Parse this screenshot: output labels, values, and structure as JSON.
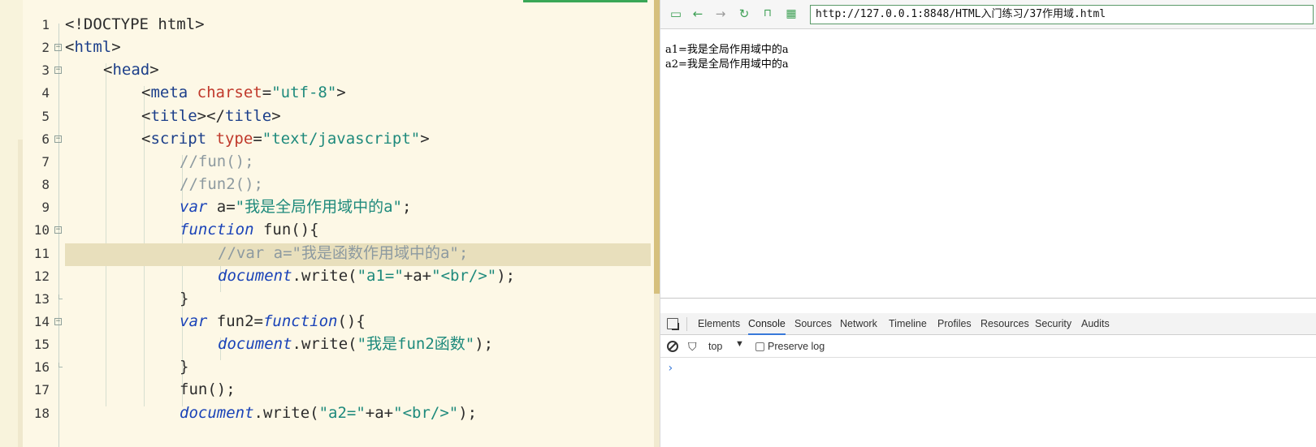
{
  "editor": {
    "lines": [
      {
        "n": "1",
        "fold": "",
        "indent": 0,
        "tokens": [
          [
            "t-punc",
            "<!DOCTYPE html>"
          ]
        ]
      },
      {
        "n": "2",
        "fold": "open",
        "indent": 0,
        "tokens": [
          [
            "t-punc",
            "<"
          ],
          [
            "t-tag",
            "html"
          ],
          [
            "t-punc",
            ">"
          ]
        ]
      },
      {
        "n": "3",
        "fold": "open",
        "indent": 1,
        "tokens": [
          [
            "t-punc",
            "<"
          ],
          [
            "t-tag",
            "head"
          ],
          [
            "t-punc",
            ">"
          ]
        ]
      },
      {
        "n": "4",
        "fold": "",
        "indent": 2,
        "tokens": [
          [
            "t-punc",
            "<"
          ],
          [
            "t-tag",
            "meta"
          ],
          [
            "t-id",
            " "
          ],
          [
            "t-attr",
            "charset"
          ],
          [
            "t-punc",
            "="
          ],
          [
            "t-str",
            "\"utf-8\""
          ],
          [
            "t-punc",
            ">"
          ]
        ]
      },
      {
        "n": "5",
        "fold": "",
        "indent": 2,
        "tokens": [
          [
            "t-punc",
            "<"
          ],
          [
            "t-tag",
            "title"
          ],
          [
            "t-punc",
            "></"
          ],
          [
            "t-tag",
            "title"
          ],
          [
            "t-punc",
            ">"
          ]
        ]
      },
      {
        "n": "6",
        "fold": "open",
        "indent": 2,
        "tokens": [
          [
            "t-punc",
            "<"
          ],
          [
            "t-tag",
            "script"
          ],
          [
            "t-id",
            " "
          ],
          [
            "t-attr",
            "type"
          ],
          [
            "t-punc",
            "="
          ],
          [
            "t-str",
            "\"text/javascript\""
          ],
          [
            "t-punc",
            ">"
          ]
        ]
      },
      {
        "n": "7",
        "fold": "",
        "indent": 3,
        "tokens": [
          [
            "t-cmt",
            "//fun();"
          ]
        ]
      },
      {
        "n": "8",
        "fold": "",
        "indent": 3,
        "tokens": [
          [
            "t-cmt",
            "//fun2();"
          ]
        ]
      },
      {
        "n": "9",
        "fold": "",
        "indent": 3,
        "tokens": [
          [
            "t-kw",
            "var"
          ],
          [
            "t-id",
            " a="
          ],
          [
            "t-str",
            "\"我是全局作用域中的a\""
          ],
          [
            "t-id",
            ";"
          ]
        ]
      },
      {
        "n": "10",
        "fold": "open",
        "indent": 3,
        "tokens": [
          [
            "t-kw",
            "function"
          ],
          [
            "t-id",
            " fun(){"
          ]
        ]
      },
      {
        "n": "11",
        "fold": "",
        "indent": 4,
        "current": true,
        "tokens": [
          [
            "t-cmt",
            "//var a=\"我是函数作用域中的a\";"
          ]
        ]
      },
      {
        "n": "12",
        "fold": "",
        "indent": 4,
        "tokens": [
          [
            "t-obj",
            "document"
          ],
          [
            "t-id",
            ".write("
          ],
          [
            "t-str",
            "\"a1=\""
          ],
          [
            "t-id",
            "+a+"
          ],
          [
            "t-str",
            "\"<br/>\""
          ],
          [
            "t-id",
            ");"
          ]
        ]
      },
      {
        "n": "13",
        "fold": "end",
        "indent": 3,
        "tokens": [
          [
            "t-id",
            "}"
          ]
        ]
      },
      {
        "n": "14",
        "fold": "open",
        "indent": 3,
        "tokens": [
          [
            "t-kw",
            "var"
          ],
          [
            "t-id",
            " fun2="
          ],
          [
            "t-kw",
            "function"
          ],
          [
            "t-id",
            "(){"
          ]
        ]
      },
      {
        "n": "15",
        "fold": "",
        "indent": 4,
        "tokens": [
          [
            "t-obj",
            "document"
          ],
          [
            "t-id",
            ".write("
          ],
          [
            "t-str",
            "\"我是fun2函数\""
          ],
          [
            "t-id",
            ");"
          ]
        ]
      },
      {
        "n": "16",
        "fold": "end",
        "indent": 3,
        "tokens": [
          [
            "t-id",
            "}"
          ]
        ]
      },
      {
        "n": "17",
        "fold": "",
        "indent": 3,
        "tokens": [
          [
            "t-id",
            "fun();"
          ]
        ]
      },
      {
        "n": "18",
        "fold": "",
        "indent": 3,
        "tokens": [
          [
            "t-obj",
            "document"
          ],
          [
            "t-id",
            ".write("
          ],
          [
            "t-str",
            "\"a2=\""
          ],
          [
            "t-id",
            "+a+"
          ],
          [
            "t-str",
            "\"<br/>\""
          ],
          [
            "t-id",
            ");"
          ]
        ]
      }
    ]
  },
  "browser": {
    "url": "http://127.0.0.1:8848/HTML入门练习/37作用域.html",
    "output": [
      "a1=我是全局作用域中的a",
      "a2=我是全局作用域中的a"
    ]
  },
  "devtools": {
    "tabs": [
      "Elements",
      "Console",
      "Sources",
      "Network",
      "Timeline",
      "Profiles",
      "Resources",
      "Security",
      "Audits"
    ],
    "active_tab": "Console",
    "context": "top",
    "preserve_log": "Preserve log",
    "prompt": "›"
  },
  "colors": {
    "accent": "#3ea055",
    "active_tab_underline": "#3879d9",
    "editor_bg": "#fdf8e6"
  }
}
